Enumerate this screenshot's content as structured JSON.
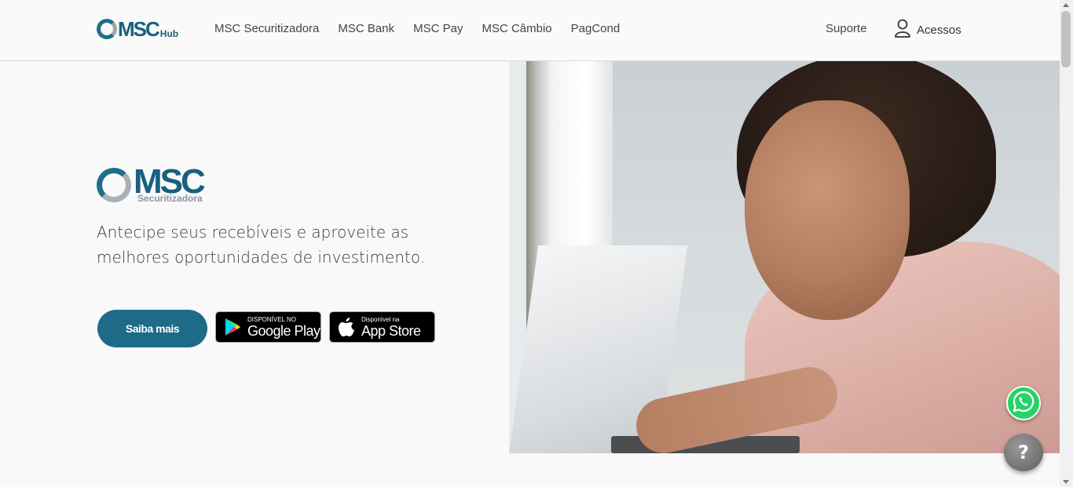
{
  "header": {
    "logo": {
      "main": "MSC",
      "suffix": "Hub"
    },
    "nav": [
      {
        "label": "MSC Securitizadora"
      },
      {
        "label": "MSC Bank"
      },
      {
        "label": "MSC Pay"
      },
      {
        "label": "MSC Câmbio"
      },
      {
        "label": "PagCond"
      }
    ],
    "support_label": "Suporte",
    "access_label": "Acessos",
    "access_icon": "user-icon"
  },
  "hero": {
    "brand": {
      "main": "MSC",
      "sub": "Securitizadora"
    },
    "headline": "Antecipe seus recebíveis e aproveite as melhores oportunidades de investimento.",
    "cta_label": "Saiba mais",
    "google_play": {
      "small": "DISPONÍVEL NO",
      "big": "Google Play",
      "icon": "google-play-icon"
    },
    "app_store": {
      "small": "Disponível na",
      "big": "App Store",
      "icon": "apple-icon"
    }
  },
  "floating": {
    "whatsapp_icon": "whatsapp-icon",
    "help_label": "?"
  },
  "colors": {
    "brand": "#17617d",
    "cta": "#1d6b88",
    "whatsapp": "#25d366"
  }
}
